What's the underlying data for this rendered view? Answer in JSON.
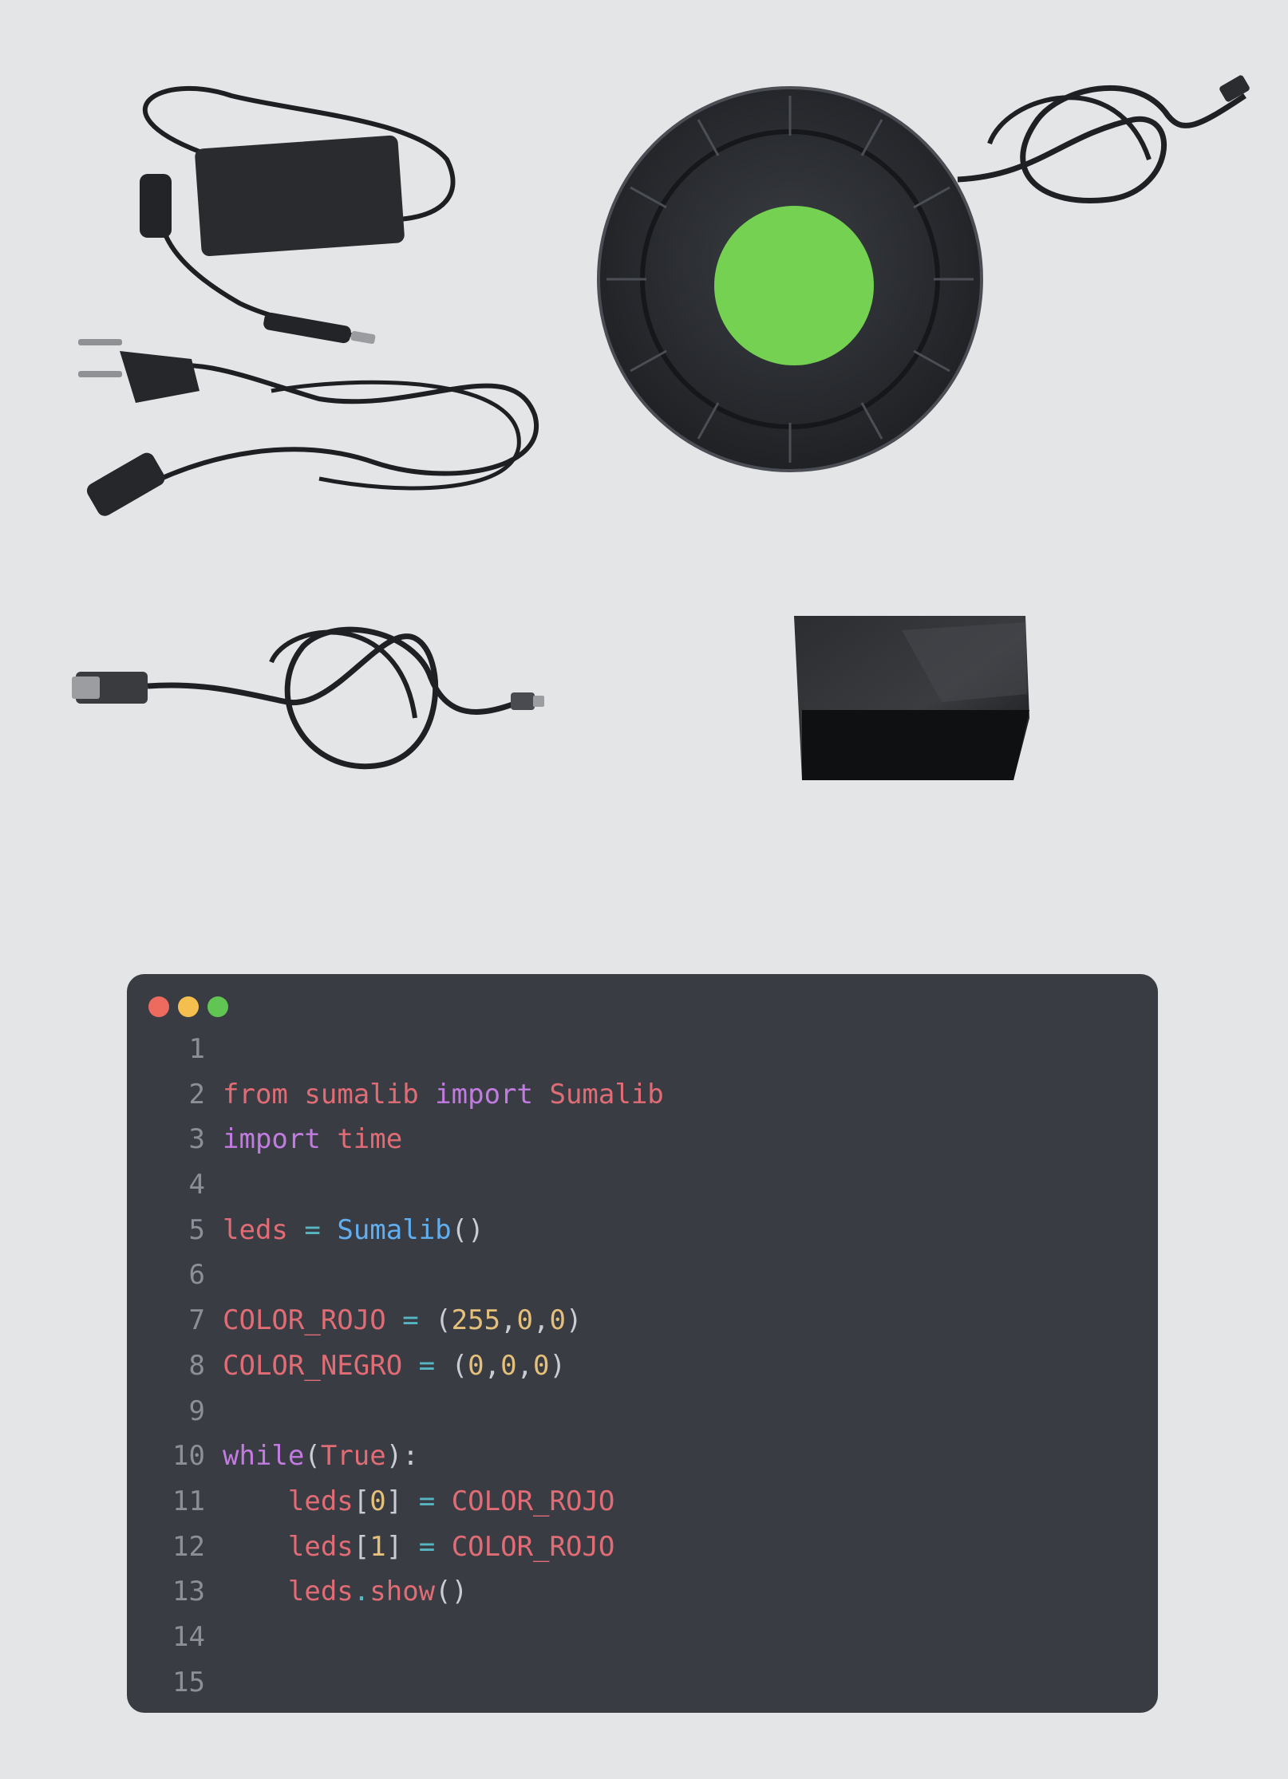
{
  "colors": {
    "page_background": "#e4e5e7",
    "editor_background": "#3a3c43",
    "traffic_light_close": "#ed6a5e",
    "traffic_light_minimize": "#f5bf4f",
    "traffic_light_zoom": "#61c554",
    "device_button": "#74d152",
    "keyword": "#c27be0",
    "identifier": "#e06c75",
    "function": "#61aff0",
    "number": "#e5c07b",
    "operator": "#56b6c2",
    "punctuation": "#c8ccd4",
    "line_number": "#8c8f98"
  },
  "photos": [
    {
      "name": "power-adapter-with-eu-plug-cable",
      "icon": "power-adapter-icon"
    },
    {
      "name": "round-led-device-with-green-button",
      "icon": "led-ring-device-icon"
    },
    {
      "name": "usb-to-micro-usb-cable",
      "icon": "usb-cable-icon"
    },
    {
      "name": "black-controller-box",
      "icon": "controller-box-icon"
    }
  ],
  "editor": {
    "lines": [
      {
        "number": "1",
        "tokens": []
      },
      {
        "number": "2",
        "tokens": [
          {
            "t": "from",
            "k": "name"
          },
          {
            "t": " ",
            "k": "p"
          },
          {
            "t": "sumalib",
            "k": "name"
          },
          {
            "t": " ",
            "k": "p"
          },
          {
            "t": "import",
            "k": "kw"
          },
          {
            "t": " ",
            "k": "p"
          },
          {
            "t": "Sumalib",
            "k": "name"
          }
        ]
      },
      {
        "number": "3",
        "tokens": [
          {
            "t": "import",
            "k": "kw"
          },
          {
            "t": " ",
            "k": "p"
          },
          {
            "t": "time",
            "k": "name"
          }
        ]
      },
      {
        "number": "4",
        "tokens": []
      },
      {
        "number": "5",
        "tokens": [
          {
            "t": "leds",
            "k": "name"
          },
          {
            "t": " ",
            "k": "p"
          },
          {
            "t": "=",
            "k": "op"
          },
          {
            "t": " ",
            "k": "p"
          },
          {
            "t": "Sumalib",
            "k": "fn"
          },
          {
            "t": "()",
            "k": "p"
          }
        ]
      },
      {
        "number": "6",
        "tokens": []
      },
      {
        "number": "7",
        "tokens": [
          {
            "t": "COLOR_ROJO",
            "k": "name"
          },
          {
            "t": " ",
            "k": "p"
          },
          {
            "t": "=",
            "k": "op"
          },
          {
            "t": " (",
            "k": "p"
          },
          {
            "t": "255",
            "k": "num"
          },
          {
            "t": ",",
            "k": "p"
          },
          {
            "t": "0",
            "k": "num"
          },
          {
            "t": ",",
            "k": "p"
          },
          {
            "t": "0",
            "k": "num"
          },
          {
            "t": ")",
            "k": "p"
          }
        ]
      },
      {
        "number": "8",
        "tokens": [
          {
            "t": "COLOR_NEGRO",
            "k": "name"
          },
          {
            "t": " ",
            "k": "p"
          },
          {
            "t": "=",
            "k": "op"
          },
          {
            "t": " (",
            "k": "p"
          },
          {
            "t": "0",
            "k": "num"
          },
          {
            "t": ",",
            "k": "p"
          },
          {
            "t": "0",
            "k": "num"
          },
          {
            "t": ",",
            "k": "p"
          },
          {
            "t": "0",
            "k": "num"
          },
          {
            "t": ")",
            "k": "p"
          }
        ]
      },
      {
        "number": "9",
        "tokens": []
      },
      {
        "number": "10",
        "tokens": [
          {
            "t": "while",
            "k": "kw"
          },
          {
            "t": "(",
            "k": "p"
          },
          {
            "t": "True",
            "k": "name"
          },
          {
            "t": "):",
            "k": "p"
          }
        ]
      },
      {
        "number": "11",
        "tokens": [
          {
            "t": "    ",
            "k": "p"
          },
          {
            "t": "leds",
            "k": "name"
          },
          {
            "t": "[",
            "k": "p"
          },
          {
            "t": "0",
            "k": "num"
          },
          {
            "t": "]",
            "k": "p"
          },
          {
            "t": " ",
            "k": "p"
          },
          {
            "t": "=",
            "k": "op"
          },
          {
            "t": " ",
            "k": "p"
          },
          {
            "t": "COLOR_ROJO",
            "k": "name"
          }
        ]
      },
      {
        "number": "12",
        "tokens": [
          {
            "t": "    ",
            "k": "p"
          },
          {
            "t": "leds",
            "k": "name"
          },
          {
            "t": "[",
            "k": "p"
          },
          {
            "t": "1",
            "k": "num"
          },
          {
            "t": "]",
            "k": "p"
          },
          {
            "t": " ",
            "k": "p"
          },
          {
            "t": "=",
            "k": "op"
          },
          {
            "t": " ",
            "k": "p"
          },
          {
            "t": "COLOR_ROJO",
            "k": "name"
          }
        ]
      },
      {
        "number": "13",
        "tokens": [
          {
            "t": "    ",
            "k": "p"
          },
          {
            "t": "leds",
            "k": "name"
          },
          {
            "t": ".",
            "k": "op"
          },
          {
            "t": "show",
            "k": "name"
          },
          {
            "t": "()",
            "k": "p"
          }
        ]
      },
      {
        "number": "14",
        "tokens": []
      },
      {
        "number": "15",
        "tokens": []
      }
    ]
  }
}
